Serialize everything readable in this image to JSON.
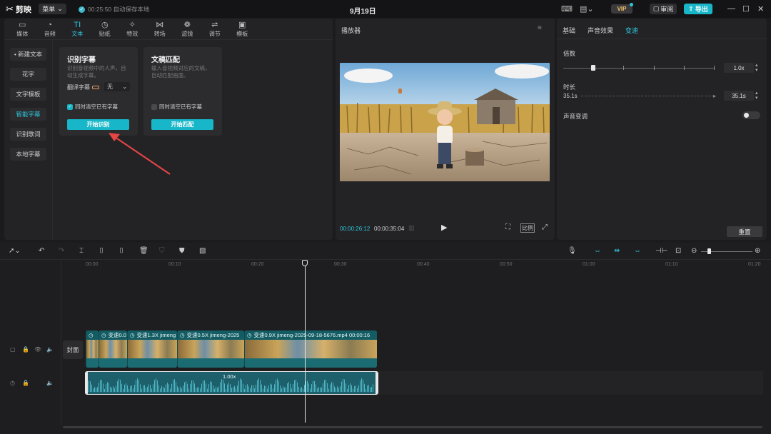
{
  "titlebar": {
    "app_name": "剪映",
    "menu_label": "菜单",
    "save_status": "00:25:50 自动保存本地",
    "date": "9月19日",
    "vip_label": "VIP",
    "review_label": "审阅",
    "export_label": "导出"
  },
  "categories": [
    {
      "label": "媒体",
      "icon": "▭"
    },
    {
      "label": "音频",
      "icon": "◔"
    },
    {
      "label": "文本",
      "icon": "TI"
    },
    {
      "label": "贴纸",
      "icon": "◷"
    },
    {
      "label": "特效",
      "icon": "✧"
    },
    {
      "label": "转场",
      "icon": "⋈"
    },
    {
      "label": "滤镜",
      "icon": "❁"
    },
    {
      "label": "调节",
      "icon": "⇌"
    },
    {
      "label": "模板",
      "icon": "▣"
    }
  ],
  "side_nav": [
    "• 新建文本",
    "花字",
    "文字模板",
    "智能字幕",
    "识别歌词",
    "本地字幕"
  ],
  "cards": {
    "recognize": {
      "title": "识别字幕",
      "desc1": "识别音视频中的人声，自",
      "desc2": "动生成字幕。",
      "translate_label": "翻译字幕",
      "translate_value": "无",
      "clear_label": "同时清空已有字幕",
      "button": "开始识别"
    },
    "match": {
      "title": "文稿匹配",
      "desc1": "输入音视频对应的文稿，",
      "desc2": "自动匹配画面。",
      "clear_label": "同时清空已有字幕",
      "button": "开始匹配"
    }
  },
  "player": {
    "title": "播放器",
    "time_current": "00:00:26:12",
    "time_total": "00:00:35:04",
    "ratio_label": "比例"
  },
  "right_panel": {
    "tabs": [
      "基础",
      "声音效果",
      "变速"
    ],
    "speed_label": "倍数",
    "speed_value": "1.0x",
    "duration_label": "时长",
    "duration_left": "35.1s",
    "duration_value": "35.1s",
    "voice_change_label": "声音变调",
    "reset_label": "重置"
  },
  "timeline": {
    "ticks": [
      "00:00",
      "00:10",
      "00:20",
      "00:30",
      "00:40",
      "00:50",
      "01:00",
      "01:10",
      "01:20"
    ],
    "cover_label": "封面",
    "clips": [
      {
        "label": "变速0.0"
      },
      {
        "label": "变速1.3X  jimeng"
      },
      {
        "label": "变速0.5X  jimeng-2025"
      },
      {
        "label": "变速0.9X  jimeng-2025-09-18-5676.mp4  00:00:16"
      }
    ],
    "audio_speed": "1.00x"
  },
  "colors": {
    "accent": "#17b6c8",
    "background": "#1b1b1d",
    "panel": "#232326"
  }
}
